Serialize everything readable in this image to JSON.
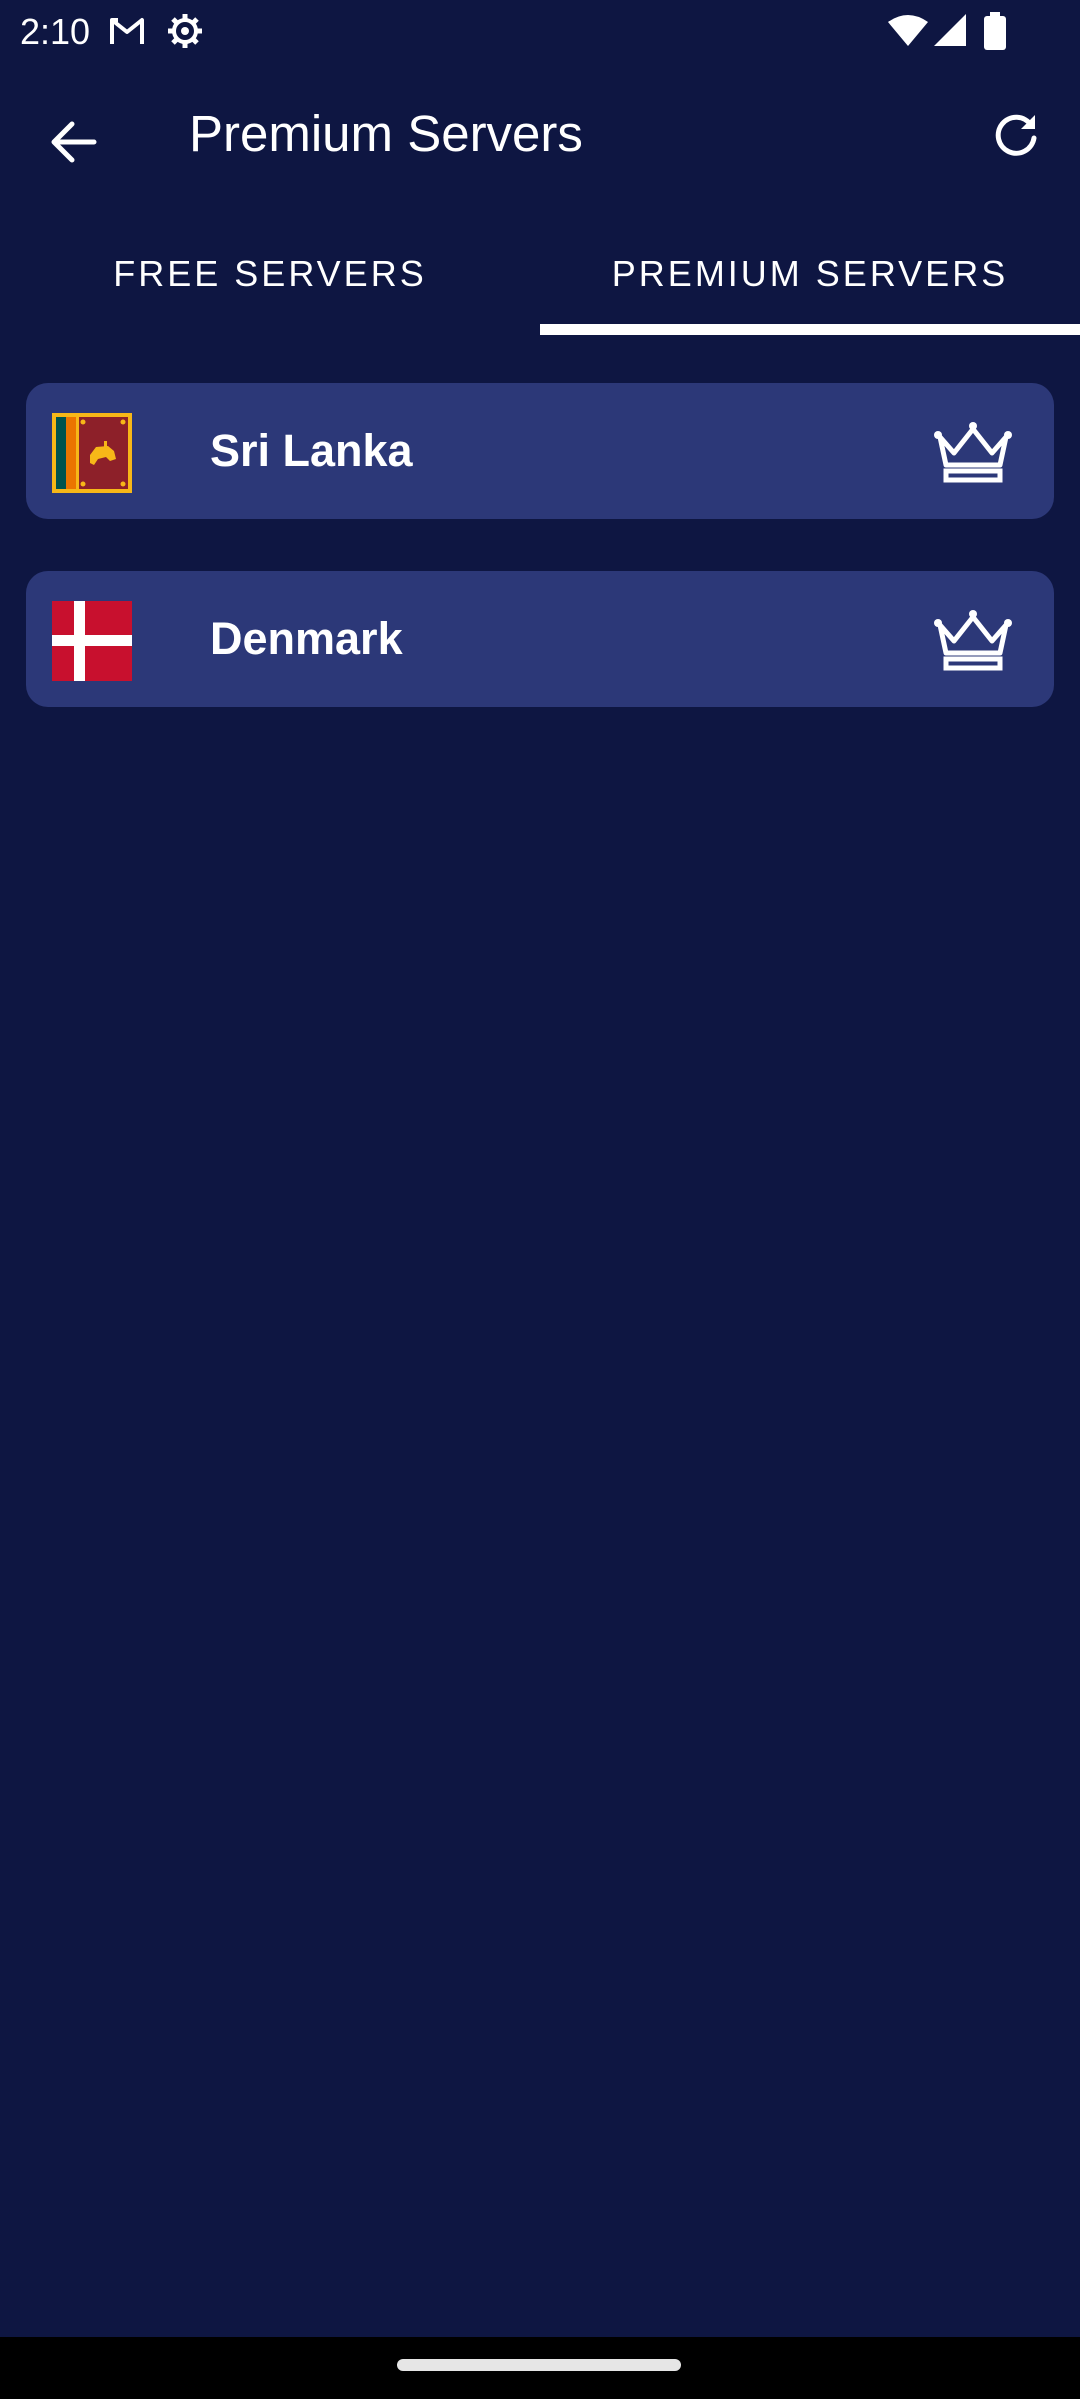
{
  "status_bar": {
    "time": "2:10",
    "icons": [
      "gmail-icon",
      "settings-gear-icon",
      "wifi-icon",
      "cell-signal-icon",
      "battery-icon"
    ]
  },
  "app_bar": {
    "title": "Premium Servers",
    "back_icon": "arrow-back-icon",
    "refresh_icon": "refresh-icon"
  },
  "tabs": [
    {
      "label": "FREE SERVERS",
      "selected": false
    },
    {
      "label": "PREMIUM SERVERS",
      "selected": true
    }
  ],
  "servers": [
    {
      "name": "Sri Lanka",
      "flag": "sri-lanka-flag-icon",
      "badge": "crown-icon"
    },
    {
      "name": "Denmark",
      "flag": "denmark-flag-icon",
      "badge": "crown-icon"
    }
  ],
  "colors": {
    "background": "#0e1642",
    "card": "#2c3878",
    "text": "#ffffff",
    "tab_indicator": "#ffffff"
  }
}
